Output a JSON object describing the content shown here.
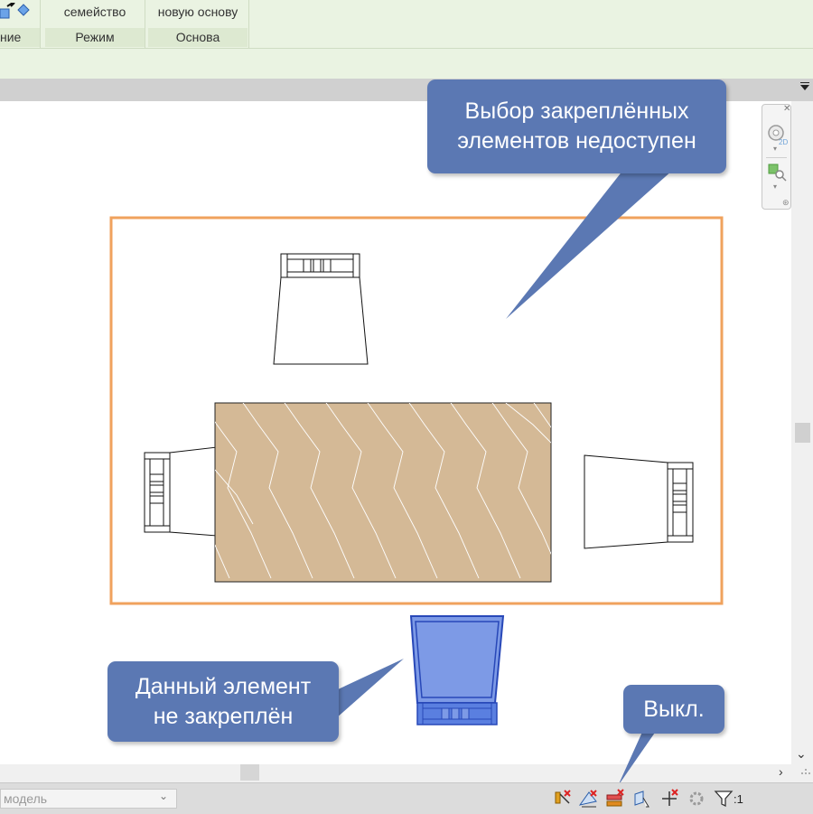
{
  "ribbon": {
    "button_1": "семейство",
    "button_2": "новую основу",
    "panel_1": "ние",
    "panel_2": "Режим",
    "panel_3": "Основа"
  },
  "callouts": {
    "pinned_line_1": "Выбор закреплённых",
    "pinned_line_2": "элементов недоступен",
    "unpinned_line_1": "Данный элемент",
    "unpinned_line_2": "не закреплён",
    "off": "Выкл."
  },
  "status_bar": {
    "model_select": "модель",
    "filter_count": ":1",
    "icons": [
      "select-links-icon",
      "select-underlay-icon",
      "select-pinned-icon",
      "select-by-face-icon",
      "drag-on-selection-icon",
      "background-process-icon",
      "filter-icon"
    ]
  },
  "navbar": {
    "icons": [
      "steering-wheel-2d-icon",
      "zoom-region-icon"
    ]
  },
  "colors": {
    "callout": "#5b78b3",
    "selection_frame": "#f0a25d",
    "table_fill": "#d4b996",
    "selected_chair": "#3d66d6",
    "ribbon_bg": "#eaf3e2"
  }
}
